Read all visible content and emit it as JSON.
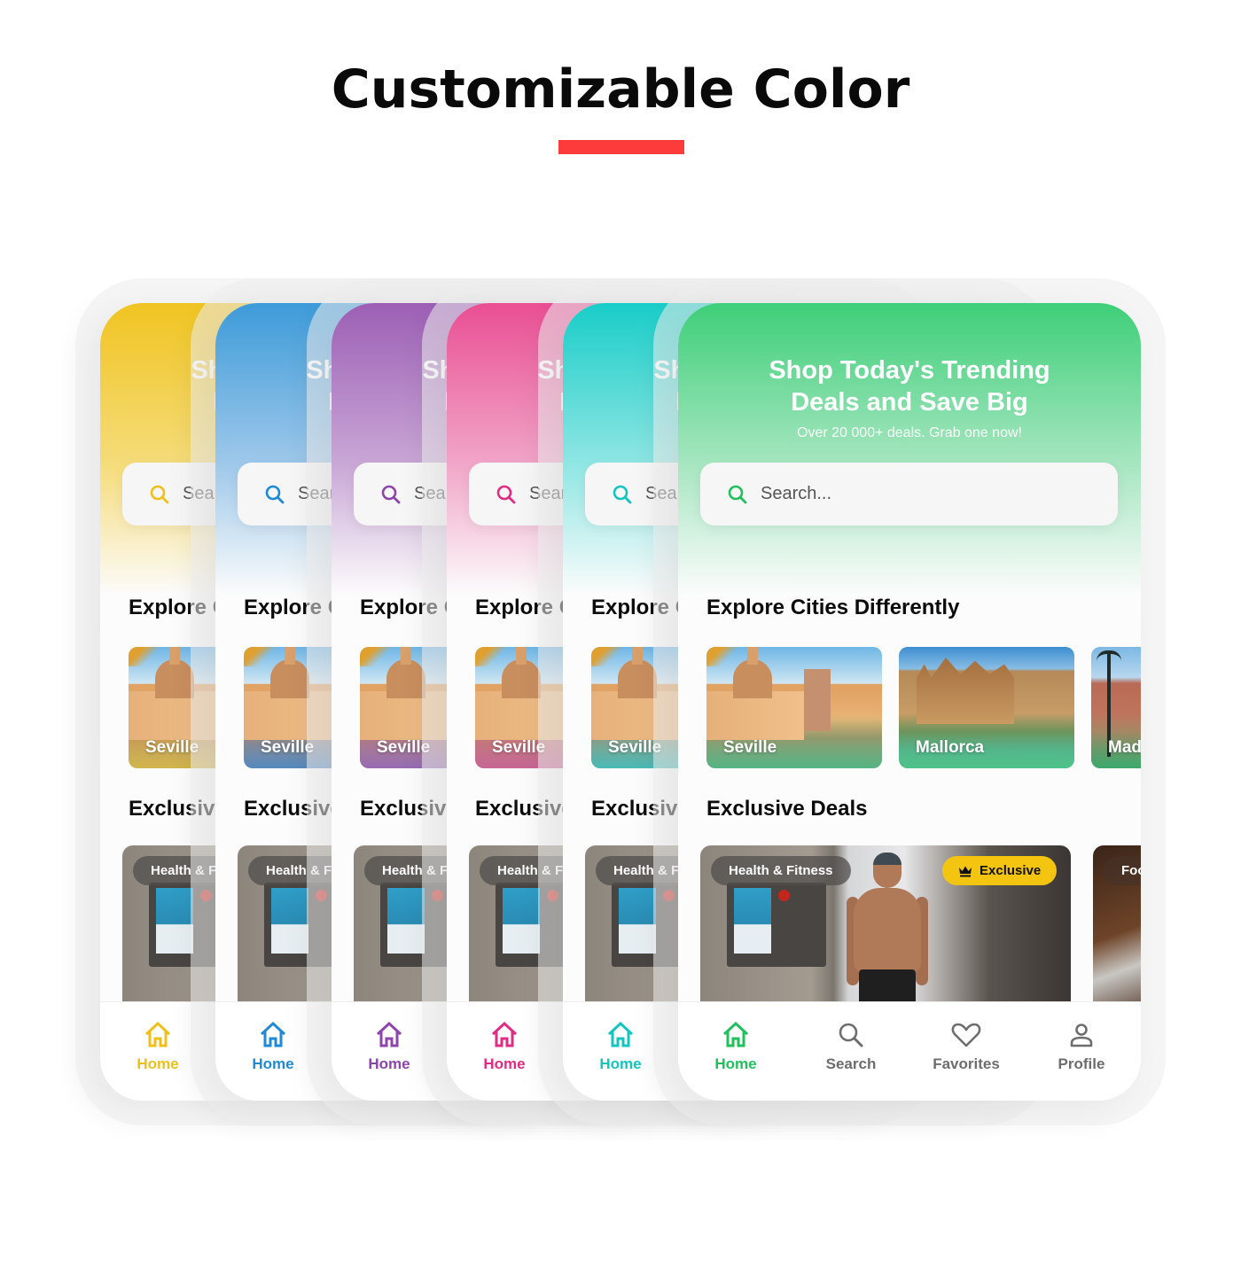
{
  "header": {
    "title": "Customizable Color",
    "underline_color": "#fe3b3b"
  },
  "themes": [
    {
      "name": "yellow",
      "accent": "#f0bf1a",
      "hero_top": "#f0c421",
      "hero_mid": "#f5dc7a",
      "tint": "rgba(240,190,30,0.65)"
    },
    {
      "name": "blue",
      "accent": "#1f8ad6",
      "hero_top": "#3d9bd9",
      "hero_mid": "#9ec8ea",
      "tint": "rgba(40,120,210,0.6)"
    },
    {
      "name": "purple",
      "accent": "#8e44ad",
      "hero_top": "#9c5fb5",
      "hero_mid": "#c9a7d6",
      "tint": "rgba(150,70,190,0.6)"
    },
    {
      "name": "pink",
      "accent": "#e22b83",
      "hero_top": "#e94f93",
      "hero_mid": "#f1a6c8",
      "tint": "rgba(230,60,140,0.6)"
    },
    {
      "name": "teal",
      "accent": "#12c5c1",
      "hero_top": "#19cdc8",
      "hero_mid": "#8fe6e3",
      "tint": "rgba(20,200,195,0.6)"
    },
    {
      "name": "green",
      "accent": "#20c05c",
      "hero_top": "#3ecf79",
      "hero_mid": "#a6e6c0",
      "tint": "rgba(40,190,110,0.6)"
    }
  ],
  "app": {
    "hero_title_line1": "Shop Today's Trending",
    "hero_title_line2": "Deals and Save Big",
    "hero_subtitle": "Over 20 000+ deals. Grab one now!",
    "search_placeholder": "Search...",
    "section_explore": "Explore Cities Differently",
    "section_deals": "Exclusive Deals",
    "cities": [
      {
        "name": "Seville"
      },
      {
        "name": "Mallorca"
      },
      {
        "name": "Madrid"
      }
    ],
    "deals": [
      {
        "category": "Health & Fitness",
        "badge": "Exclusive",
        "badge_color": "#f3c511"
      },
      {
        "category": "Food"
      }
    ],
    "tabs": [
      {
        "label": "Home",
        "icon": "home-icon",
        "active": true
      },
      {
        "label": "Search",
        "icon": "search-icon",
        "active": false
      },
      {
        "label": "Favorites",
        "icon": "heart-icon",
        "active": false
      },
      {
        "label": "Profile",
        "icon": "user-icon",
        "active": false
      }
    ],
    "inactive_tab_color": "#6d6d6d"
  }
}
